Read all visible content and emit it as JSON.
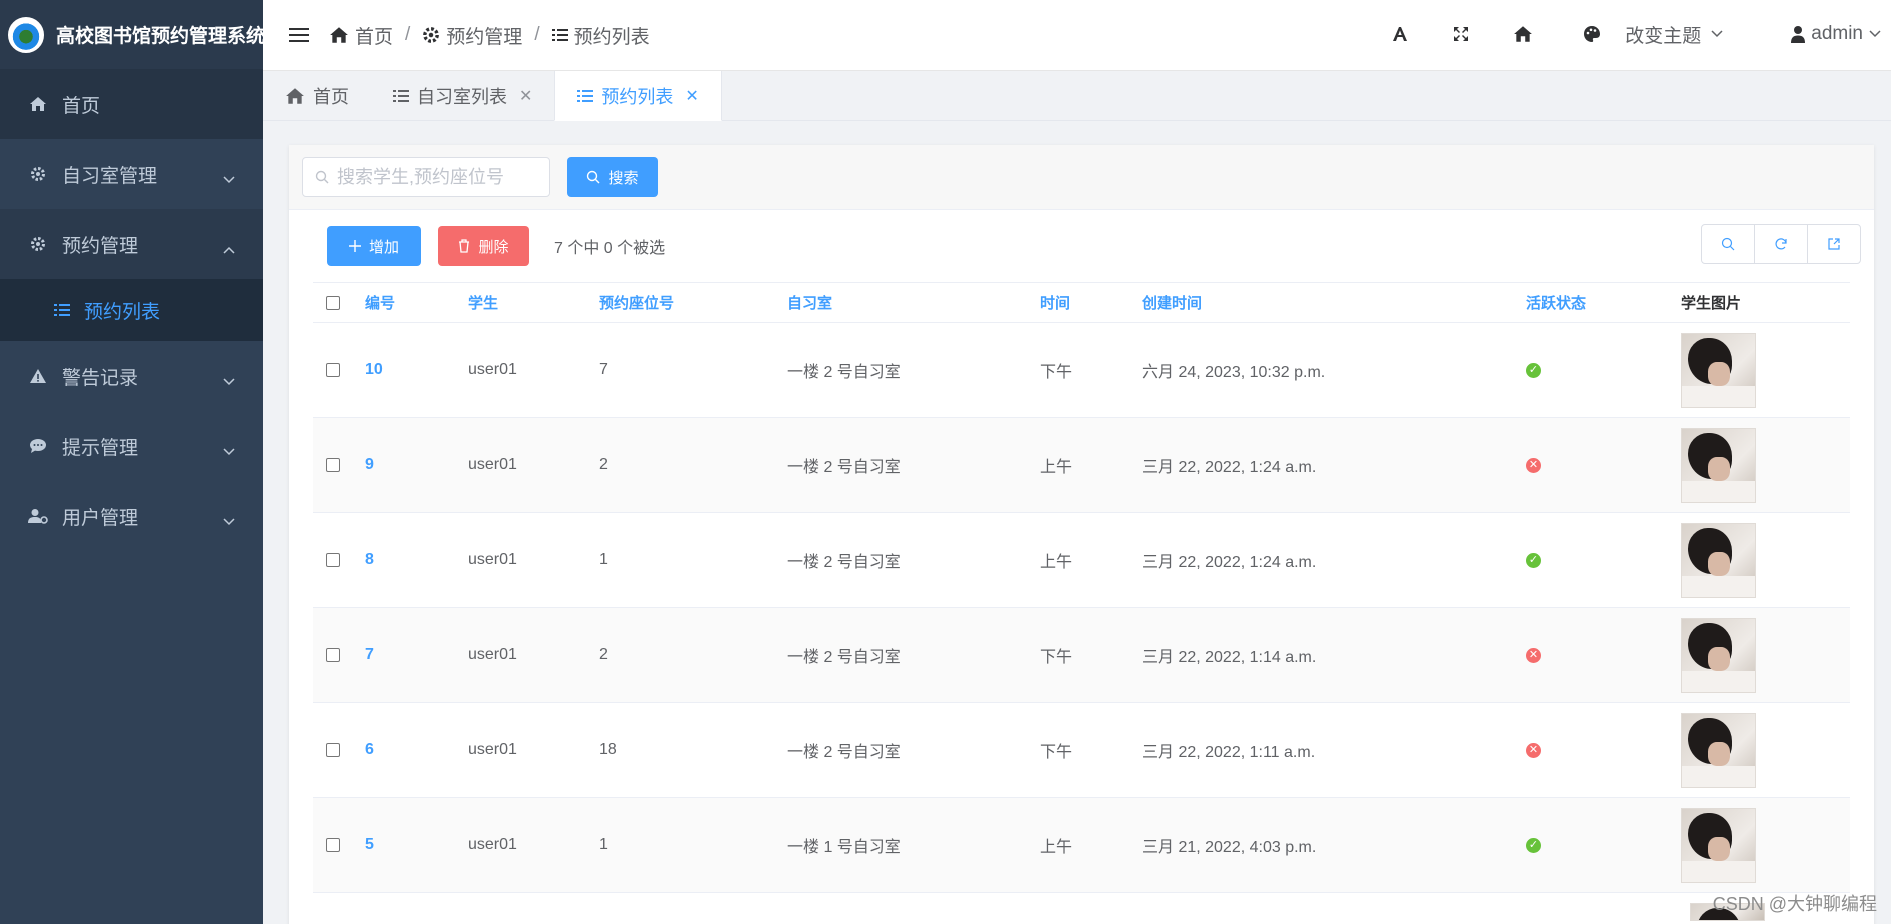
{
  "app": {
    "title": "高校图书馆预约管理系统"
  },
  "sidebar": {
    "items": [
      {
        "label": "首页"
      },
      {
        "label": "自习室管理"
      },
      {
        "label": "预约管理"
      },
      {
        "label": "警告记录"
      },
      {
        "label": "提示管理"
      },
      {
        "label": "用户管理"
      }
    ],
    "sub_active": {
      "label": "预约列表"
    }
  },
  "breadcrumb": [
    "首页",
    "预约管理",
    "预约列表"
  ],
  "topbar": {
    "theme_label": "改变主题",
    "user_label": "admin"
  },
  "tabs": [
    {
      "label": "首页"
    },
    {
      "label": "自习室列表"
    },
    {
      "label": "预约列表"
    }
  ],
  "search": {
    "placeholder": "搜索学生,预约座位号",
    "button_label": "搜索"
  },
  "actions": {
    "add_label": "增加",
    "delete_label": "删除",
    "selection_text": "7 个中 0 个被选"
  },
  "table": {
    "columns": [
      "编号",
      "学生",
      "预约座位号",
      "自习室",
      "时间",
      "创建时间",
      "活跃状态",
      "学生图片"
    ],
    "rows": [
      {
        "id": "10",
        "student": "user01",
        "seat": "7",
        "room": "一楼 2 号自习室",
        "time": "下午",
        "created": "六月 24, 2023, 10:32 p.m.",
        "active": true
      },
      {
        "id": "9",
        "student": "user01",
        "seat": "2",
        "room": "一楼 2 号自习室",
        "time": "上午",
        "created": "三月 22, 2022, 1:24 a.m.",
        "active": false
      },
      {
        "id": "8",
        "student": "user01",
        "seat": "1",
        "room": "一楼 2 号自习室",
        "time": "上午",
        "created": "三月 22, 2022, 1:24 a.m.",
        "active": true
      },
      {
        "id": "7",
        "student": "user01",
        "seat": "2",
        "room": "一楼 2 号自习室",
        "time": "下午",
        "created": "三月 22, 2022, 1:14 a.m.",
        "active": false
      },
      {
        "id": "6",
        "student": "user01",
        "seat": "18",
        "room": "一楼 2 号自习室",
        "time": "下午",
        "created": "三月 22, 2022, 1:11 a.m.",
        "active": false
      },
      {
        "id": "5",
        "student": "user01",
        "seat": "1",
        "room": "一楼 1 号自习室",
        "time": "上午",
        "created": "三月 21, 2022, 4:03 p.m.",
        "active": true
      }
    ]
  },
  "watermark": "CSDN @大钟聊编程",
  "colors": {
    "primary": "#409eff",
    "danger": "#f56c6c",
    "success": "#67c23a",
    "sidebar_bg": "#304156"
  },
  "icons": [
    "home-icon",
    "gear-icon",
    "list-icon",
    "warning-icon",
    "chat-icon",
    "user-gear-icon",
    "font-icon",
    "fullscreen-icon",
    "palette-icon",
    "user-icon",
    "search-icon",
    "plus-icon",
    "trash-icon",
    "refresh-icon",
    "export-icon"
  ]
}
